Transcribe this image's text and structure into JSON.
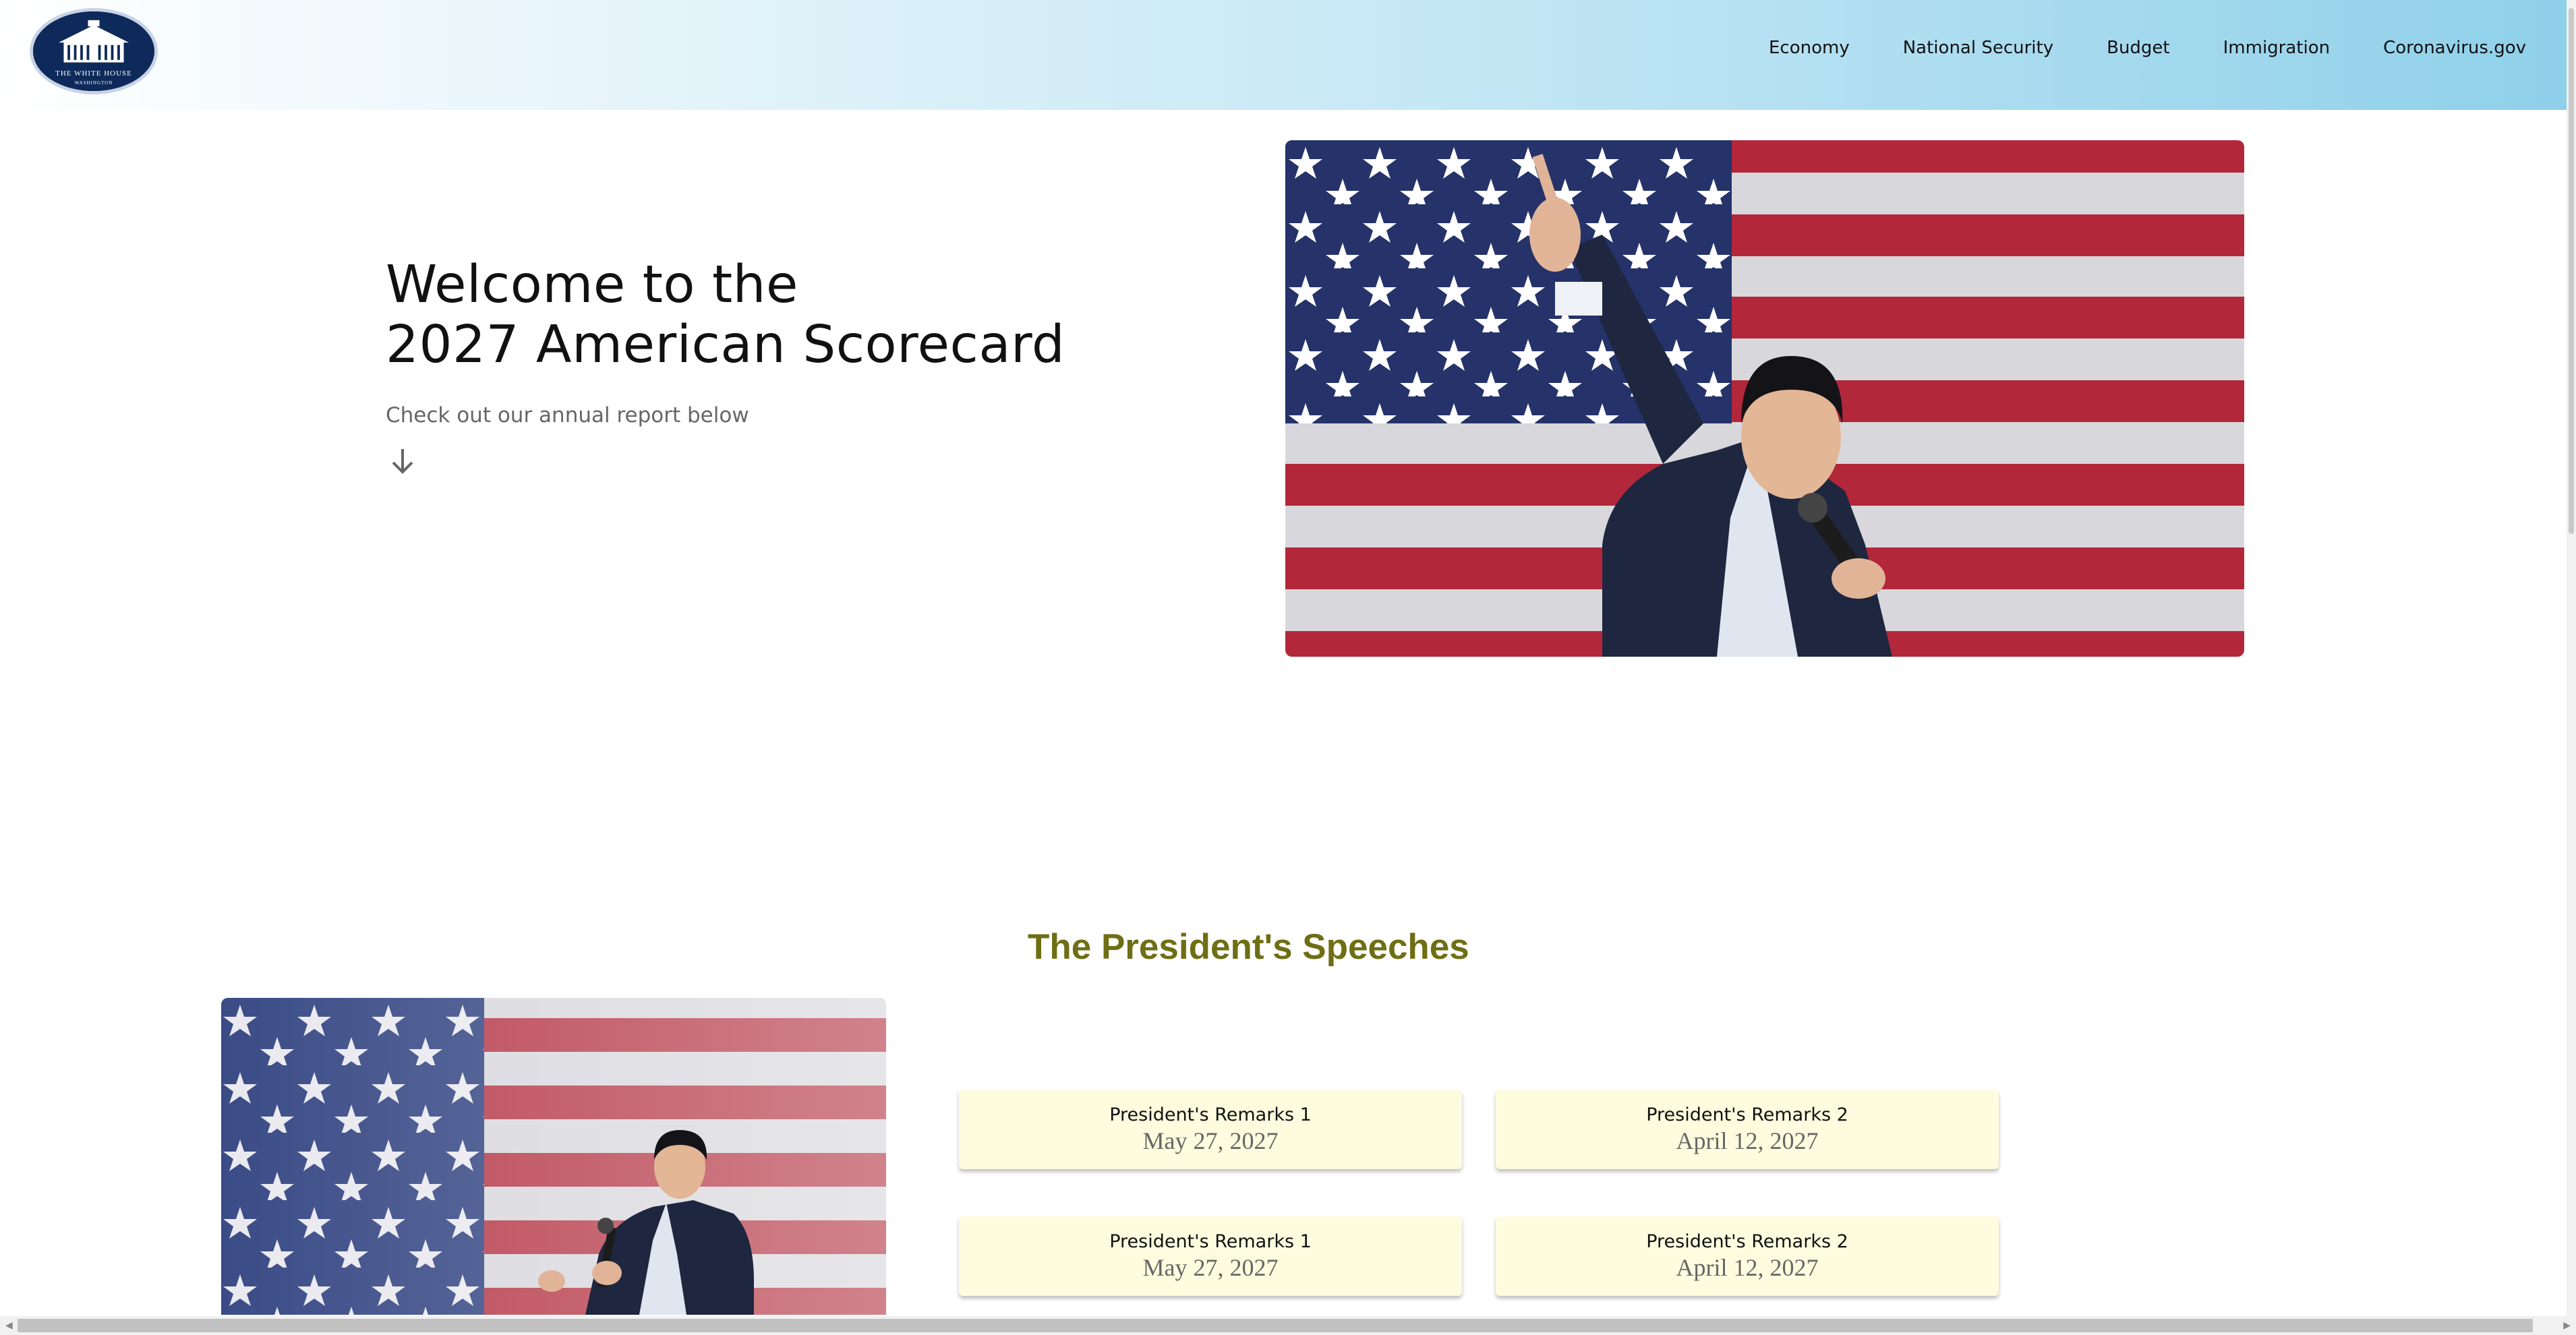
{
  "header": {
    "logo": {
      "icon": "white-house-seal-icon",
      "line1": "THE WHITE HOUSE",
      "line2": "WASHINGTON"
    },
    "nav": [
      {
        "label": "Economy"
      },
      {
        "label": "National Security"
      },
      {
        "label": "Budget"
      },
      {
        "label": "Immigration"
      },
      {
        "label": "Coronavirus.gov"
      }
    ]
  },
  "hero": {
    "title_line1": "Welcome to the",
    "title_line2": "2027 American Scorecard",
    "subtitle": "Check out our annual report below",
    "arrow_icon": "arrow-down-icon",
    "image": "speaker-pointing-up-flag-photo"
  },
  "speeches": {
    "title": "The President's Speeches",
    "image": "speaker-with-microphone-flag-photo",
    "cards": [
      {
        "title": "President's Remarks 1",
        "date": "May 27, 2027"
      },
      {
        "title": "President's Remarks 2",
        "date": "April 12, 2027"
      },
      {
        "title": "President's Remarks 1",
        "date": "May 27, 2027"
      },
      {
        "title": "President's Remarks 2",
        "date": "April 12, 2027"
      }
    ]
  },
  "colors": {
    "header_gradient_end": "#8fd0ea",
    "speeches_title": "#6e6e14",
    "card_bg": "#fdfcde",
    "flag_red": "#b22234",
    "flag_blue": "#1f2e6b"
  }
}
